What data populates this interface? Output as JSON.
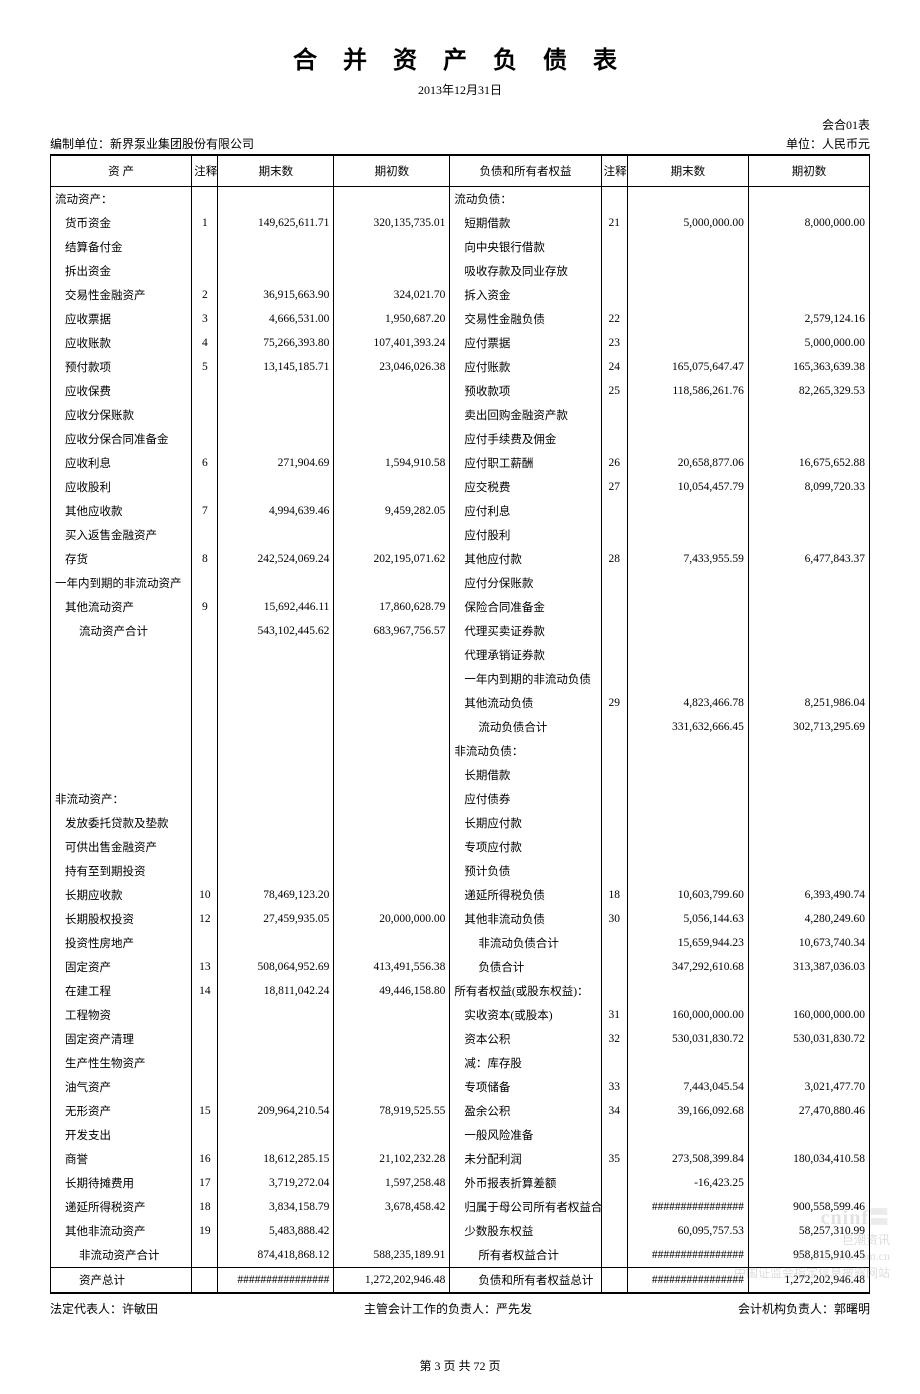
{
  "title": "合 并 资 产 负 债 表",
  "date": "2013年12月31日",
  "form_code": "会合01表",
  "preparer_label": "编制单位：",
  "preparer_name": "新界泵业集团股份有限公司",
  "currency_label": "单位：人民币元",
  "headers": {
    "asset": "资  产",
    "note": "注释",
    "end": "期末数",
    "begin": "期初数",
    "liab": "负债和所有者权益"
  },
  "rows": [
    {
      "a": "流动资产：",
      "an": "",
      "ae": "",
      "ab": "",
      "l": "流动负债：",
      "ln": "",
      "le": "",
      "lb": "",
      "ai": 0,
      "li": 0
    },
    {
      "a": "货币资金",
      "an": "1",
      "ae": "149,625,611.71",
      "ab": "320,135,735.01",
      "l": "短期借款",
      "ln": "21",
      "le": "5,000,000.00",
      "lb": "8,000,000.00",
      "ai": 1,
      "li": 1
    },
    {
      "a": "结算备付金",
      "an": "",
      "ae": "",
      "ab": "",
      "l": "向中央银行借款",
      "ln": "",
      "le": "",
      "lb": "",
      "ai": 1,
      "li": 1
    },
    {
      "a": "拆出资金",
      "an": "",
      "ae": "",
      "ab": "",
      "l": "吸收存款及同业存放",
      "ln": "",
      "le": "",
      "lb": "",
      "ai": 1,
      "li": 1
    },
    {
      "a": "交易性金融资产",
      "an": "2",
      "ae": "36,915,663.90",
      "ab": "324,021.70",
      "l": "拆入资金",
      "ln": "",
      "le": "",
      "lb": "",
      "ai": 1,
      "li": 1
    },
    {
      "a": "应收票据",
      "an": "3",
      "ae": "4,666,531.00",
      "ab": "1,950,687.20",
      "l": "交易性金融负债",
      "ln": "22",
      "le": "",
      "lb": "2,579,124.16",
      "ai": 1,
      "li": 1
    },
    {
      "a": "应收账款",
      "an": "4",
      "ae": "75,266,393.80",
      "ab": "107,401,393.24",
      "l": "应付票据",
      "ln": "23",
      "le": "",
      "lb": "5,000,000.00",
      "ai": 1,
      "li": 1
    },
    {
      "a": "预付款项",
      "an": "5",
      "ae": "13,145,185.71",
      "ab": "23,046,026.38",
      "l": "应付账款",
      "ln": "24",
      "le": "165,075,647.47",
      "lb": "165,363,639.38",
      "ai": 1,
      "li": 1
    },
    {
      "a": "应收保费",
      "an": "",
      "ae": "",
      "ab": "",
      "l": "预收款项",
      "ln": "25",
      "le": "118,586,261.76",
      "lb": "82,265,329.53",
      "ai": 1,
      "li": 1
    },
    {
      "a": "应收分保账款",
      "an": "",
      "ae": "",
      "ab": "",
      "l": "卖出回购金融资产款",
      "ln": "",
      "le": "",
      "lb": "",
      "ai": 1,
      "li": 1
    },
    {
      "a": "应收分保合同准备金",
      "an": "",
      "ae": "",
      "ab": "",
      "l": "应付手续费及佣金",
      "ln": "",
      "le": "",
      "lb": "",
      "ai": 1,
      "li": 1
    },
    {
      "a": "应收利息",
      "an": "6",
      "ae": "271,904.69",
      "ab": "1,594,910.58",
      "l": "应付职工薪酬",
      "ln": "26",
      "le": "20,658,877.06",
      "lb": "16,675,652.88",
      "ai": 1,
      "li": 1
    },
    {
      "a": "应收股利",
      "an": "",
      "ae": "",
      "ab": "",
      "l": "应交税费",
      "ln": "27",
      "le": "10,054,457.79",
      "lb": "8,099,720.33",
      "ai": 1,
      "li": 1
    },
    {
      "a": "其他应收款",
      "an": "7",
      "ae": "4,994,639.46",
      "ab": "9,459,282.05",
      "l": "应付利息",
      "ln": "",
      "le": "",
      "lb": "",
      "ai": 1,
      "li": 1
    },
    {
      "a": "买入返售金融资产",
      "an": "",
      "ae": "",
      "ab": "",
      "l": "应付股利",
      "ln": "",
      "le": "",
      "lb": "",
      "ai": 1,
      "li": 1
    },
    {
      "a": "存货",
      "an": "8",
      "ae": "242,524,069.24",
      "ab": "202,195,071.62",
      "l": "其他应付款",
      "ln": "28",
      "le": "7,433,955.59",
      "lb": "6,477,843.37",
      "ai": 1,
      "li": 1
    },
    {
      "a": "一年内到期的非流动资产",
      "an": "",
      "ae": "",
      "ab": "",
      "l": "应付分保账款",
      "ln": "",
      "le": "",
      "lb": "",
      "ai": 0,
      "li": 1
    },
    {
      "a": "其他流动资产",
      "an": "9",
      "ae": "15,692,446.11",
      "ab": "17,860,628.79",
      "l": "保险合同准备金",
      "ln": "",
      "le": "",
      "lb": "",
      "ai": 1,
      "li": 1
    },
    {
      "a": "流动资产合计",
      "an": "",
      "ae": "543,102,445.62",
      "ab": "683,967,756.57",
      "l": "代理买卖证券款",
      "ln": "",
      "le": "",
      "lb": "",
      "ai": 2,
      "li": 1
    },
    {
      "a": "",
      "an": "",
      "ae": "",
      "ab": "",
      "l": "代理承销证券款",
      "ln": "",
      "le": "",
      "lb": "",
      "ai": 0,
      "li": 1
    },
    {
      "a": "",
      "an": "",
      "ae": "",
      "ab": "",
      "l": "一年内到期的非流动负债",
      "ln": "",
      "le": "",
      "lb": "",
      "ai": 0,
      "li": 1
    },
    {
      "a": "",
      "an": "",
      "ae": "",
      "ab": "",
      "l": "其他流动负债",
      "ln": "29",
      "le": "4,823,466.78",
      "lb": "8,251,986.04",
      "ai": 0,
      "li": 1
    },
    {
      "a": "",
      "an": "",
      "ae": "",
      "ab": "",
      "l": "流动负债合计",
      "ln": "",
      "le": "331,632,666.45",
      "lb": "302,713,295.69",
      "ai": 0,
      "li": 2
    },
    {
      "a": "",
      "an": "",
      "ae": "",
      "ab": "",
      "l": "非流动负债：",
      "ln": "",
      "le": "",
      "lb": "",
      "ai": 0,
      "li": 0
    },
    {
      "a": "",
      "an": "",
      "ae": "",
      "ab": "",
      "l": "长期借款",
      "ln": "",
      "le": "",
      "lb": "",
      "ai": 0,
      "li": 1
    },
    {
      "a": "非流动资产：",
      "an": "",
      "ae": "",
      "ab": "",
      "l": "应付债券",
      "ln": "",
      "le": "",
      "lb": "",
      "ai": 0,
      "li": 1
    },
    {
      "a": "发放委托贷款及垫款",
      "an": "",
      "ae": "",
      "ab": "",
      "l": "长期应付款",
      "ln": "",
      "le": "",
      "lb": "",
      "ai": 1,
      "li": 1
    },
    {
      "a": "可供出售金融资产",
      "an": "",
      "ae": "",
      "ab": "",
      "l": "专项应付款",
      "ln": "",
      "le": "",
      "lb": "",
      "ai": 1,
      "li": 1
    },
    {
      "a": "持有至到期投资",
      "an": "",
      "ae": "",
      "ab": "",
      "l": "预计负债",
      "ln": "",
      "le": "",
      "lb": "",
      "ai": 1,
      "li": 1
    },
    {
      "a": "长期应收款",
      "an": "10",
      "ae": "78,469,123.20",
      "ab": "",
      "l": "递延所得税负债",
      "ln": "18",
      "le": "10,603,799.60",
      "lb": "6,393,490.74",
      "ai": 1,
      "li": 1
    },
    {
      "a": "长期股权投资",
      "an": "12",
      "ae": "27,459,935.05",
      "ab": "20,000,000.00",
      "l": "其他非流动负债",
      "ln": "30",
      "le": "5,056,144.63",
      "lb": "4,280,249.60",
      "ai": 1,
      "li": 1
    },
    {
      "a": "投资性房地产",
      "an": "",
      "ae": "",
      "ab": "",
      "l": "非流动负债合计",
      "ln": "",
      "le": "15,659,944.23",
      "lb": "10,673,740.34",
      "ai": 1,
      "li": 2
    },
    {
      "a": "固定资产",
      "an": "13",
      "ae": "508,064,952.69",
      "ab": "413,491,556.38",
      "l": "负债合计",
      "ln": "",
      "le": "347,292,610.68",
      "lb": "313,387,036.03",
      "ai": 1,
      "li": 2
    },
    {
      "a": "在建工程",
      "an": "14",
      "ae": "18,811,042.24",
      "ab": "49,446,158.80",
      "l": "所有者权益(或股东权益)：",
      "ln": "",
      "le": "",
      "lb": "",
      "ai": 1,
      "li": 0
    },
    {
      "a": "工程物资",
      "an": "",
      "ae": "",
      "ab": "",
      "l": "实收资本(或股本)",
      "ln": "31",
      "le": "160,000,000.00",
      "lb": "160,000,000.00",
      "ai": 1,
      "li": 1
    },
    {
      "a": "固定资产清理",
      "an": "",
      "ae": "",
      "ab": "",
      "l": "资本公积",
      "ln": "32",
      "le": "530,031,830.72",
      "lb": "530,031,830.72",
      "ai": 1,
      "li": 1
    },
    {
      "a": "生产性生物资产",
      "an": "",
      "ae": "",
      "ab": "",
      "l": "减：库存股",
      "ln": "",
      "le": "",
      "lb": "",
      "ai": 1,
      "li": 1
    },
    {
      "a": "油气资产",
      "an": "",
      "ae": "",
      "ab": "",
      "l": "专项储备",
      "ln": "33",
      "le": "7,443,045.54",
      "lb": "3,021,477.70",
      "ai": 1,
      "li": 1
    },
    {
      "a": "无形资产",
      "an": "15",
      "ae": "209,964,210.54",
      "ab": "78,919,525.55",
      "l": "盈余公积",
      "ln": "34",
      "le": "39,166,092.68",
      "lb": "27,470,880.46",
      "ai": 1,
      "li": 1
    },
    {
      "a": "开发支出",
      "an": "",
      "ae": "",
      "ab": "",
      "l": "一般风险准备",
      "ln": "",
      "le": "",
      "lb": "",
      "ai": 1,
      "li": 1
    },
    {
      "a": "商誉",
      "an": "16",
      "ae": "18,612,285.15",
      "ab": "21,102,232.28",
      "l": "未分配利润",
      "ln": "35",
      "le": "273,508,399.84",
      "lb": "180,034,410.58",
      "ai": 1,
      "li": 1
    },
    {
      "a": "长期待摊费用",
      "an": "17",
      "ae": "3,719,272.04",
      "ab": "1,597,258.48",
      "l": "外币报表折算差额",
      "ln": "",
      "le": "-16,423.25",
      "lb": "",
      "ai": 1,
      "li": 1
    },
    {
      "a": "递延所得税资产",
      "an": "18",
      "ae": "3,834,158.79",
      "ab": "3,678,458.42",
      "l": "归属于母公司所有者权益合计",
      "ln": "",
      "le": "################",
      "lb": "900,558,599.46",
      "ai": 1,
      "li": 1
    },
    {
      "a": "其他非流动资产",
      "an": "19",
      "ae": "5,483,888.42",
      "ab": "",
      "l": "少数股东权益",
      "ln": "",
      "le": "60,095,757.53",
      "lb": "58,257,310.99",
      "ai": 1,
      "li": 1
    },
    {
      "a": "非流动资产合计",
      "an": "",
      "ae": "874,418,868.12",
      "ab": "588,235,189.91",
      "l": "所有者权益合计",
      "ln": "",
      "le": "################",
      "lb": "958,815,910.45",
      "ai": 2,
      "li": 2
    },
    {
      "a": "资产总计",
      "an": "",
      "ae": "################",
      "ab": "1,272,202,946.48",
      "l": "负债和所有者权益总计",
      "ln": "",
      "le": "################",
      "lb": "1,272,202,946.48",
      "ai": 2,
      "li": 2,
      "total": true
    }
  ],
  "signers": {
    "legal_rep_label": "法定代表人：",
    "legal_rep_name": "许敏田",
    "acct_head_label": "主管会计工作的负责人：",
    "acct_head_name": "严先发",
    "acct_org_label": "会计机构负责人：",
    "acct_org_name": "郭曙明"
  },
  "pager": "第 3 页 共 72 页",
  "watermark": {
    "logo": "cninf",
    "sub": "巨潮资讯",
    "url": "www.cninfo.com.cn",
    "desc": "中国证监会指定信息披露网站"
  }
}
